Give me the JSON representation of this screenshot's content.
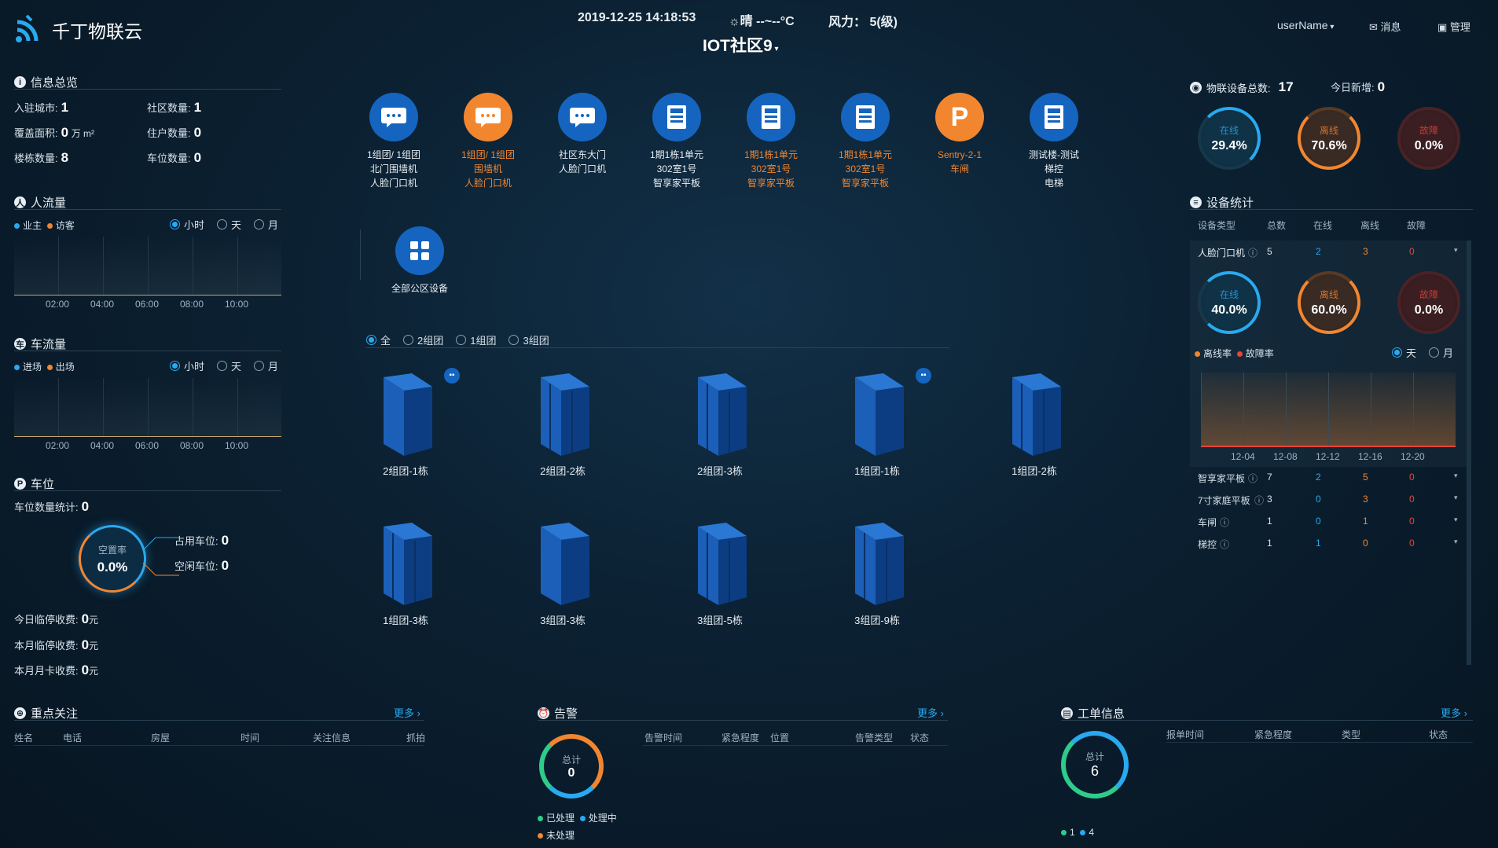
{
  "app": {
    "title": "千丁物联云"
  },
  "topbar": {
    "datetime": "2019-12-25 14:18:53",
    "weather": "晴 --~--°C",
    "wind": "风力： 5(级)",
    "community": "IOT社区9",
    "user": "userName",
    "messages": "消息",
    "admin": "管理"
  },
  "info": {
    "title": "信息总览",
    "city_label": "入驻城市:",
    "city": "1",
    "community_label": "社区数量:",
    "community": "1",
    "area_label": "覆盖面积:",
    "area": "0",
    "area_unit": "万 m²",
    "households_label": "住户数量:",
    "households": "0",
    "buildings_label": "楼栋数量:",
    "buildings": "8",
    "parking_label": "车位数量:",
    "parking": "0"
  },
  "people_flow": {
    "title": "人流量",
    "legend": [
      "业主",
      "访客"
    ],
    "options": [
      "小时",
      "天",
      "月"
    ],
    "selected": "小时",
    "x_ticks": [
      "02:00",
      "04:00",
      "06:00",
      "08:00",
      "10:00"
    ]
  },
  "car_flow": {
    "title": "车流量",
    "legend": [
      "进场",
      "出场"
    ],
    "options": [
      "小时",
      "天",
      "月"
    ],
    "selected": "小时",
    "x_ticks": [
      "02:00",
      "04:00",
      "06:00",
      "08:00",
      "10:00"
    ]
  },
  "parking": {
    "title": "车位",
    "stats_label": "车位数量统计:",
    "stats": "0",
    "ring_label": "空置率",
    "ring_value": "0.0%",
    "used_label": "占用车位:",
    "used": "0",
    "free_label": "空闲车位:",
    "free": "0",
    "today_label": "今日临停收费:",
    "today": "0",
    "month_label": "本月临停收费:",
    "month": "0",
    "card_label": "本月月卡收费:",
    "card": "0",
    "currency": "元"
  },
  "devices": [
    {
      "lines": [
        "1组团/ 1组团",
        "北门围墙机",
        "人脸门口机"
      ],
      "icon": "chat-icon",
      "color": "#1565c0",
      "state": "normal"
    },
    {
      "lines": [
        "1组团/ 1组团",
        "围墙机",
        "人脸门口机"
      ],
      "icon": "chat-icon",
      "color": "#f2862f",
      "state": "alert"
    },
    {
      "lines": [
        "社区东大门",
        "人脸门口机"
      ],
      "icon": "chat-icon",
      "color": "#1565c0",
      "state": "normal"
    },
    {
      "lines": [
        "1期1栋1单元",
        "302室1号",
        "智享家平板"
      ],
      "icon": "tablet-icon",
      "color": "#1565c0",
      "state": "normal"
    },
    {
      "lines": [
        "1期1栋1单元",
        "302室1号",
        "智享家平板"
      ],
      "icon": "tablet-icon",
      "color": "#1565c0",
      "state": "alert"
    },
    {
      "lines": [
        "1期1栋1单元",
        "302室1号",
        "智享家平板"
      ],
      "icon": "tablet-icon",
      "color": "#1565c0",
      "state": "alert"
    },
    {
      "lines": [
        "Sentry-2-1",
        "车闸"
      ],
      "icon": "parking-gate-icon",
      "color": "#f2862f",
      "state": "alert"
    },
    {
      "lines": [
        "测试楼-测试",
        "梯控",
        "电梯"
      ],
      "icon": "tablet-icon",
      "color": "#1565c0",
      "state": "normal"
    }
  ],
  "all_devices": "全部公区设备",
  "group_filter": {
    "options": [
      "全",
      "2组团",
      "1组团",
      "3组团"
    ],
    "selected": "全"
  },
  "buildings": [
    "2组团-1栋",
    "2组团-2栋",
    "2组团-3栋",
    "1组团-1栋",
    "1组团-2栋",
    "1组团-3栋",
    "3组团-3栋",
    "3组团-5栋",
    "3组团-9栋"
  ],
  "iot": {
    "total_label": "物联设备总数:",
    "total": "17",
    "new_label": "今日新增:",
    "new": "0",
    "online_label": "在线",
    "online": "29.4%",
    "offline_label": "离线",
    "offline": "70.6%",
    "fault_label": "故障",
    "fault": "0.0%"
  },
  "device_stats": {
    "title": "设备统计",
    "headers": [
      "设备类型",
      "总数",
      "在线",
      "离线",
      "故障"
    ],
    "first_row": {
      "name": "人脸门口机",
      "total": "5",
      "online": "2",
      "offline": "3",
      "fault": "0"
    },
    "rings": {
      "online": "40.0%",
      "offline": "60.0%",
      "fault": "0.0%",
      "online_label": "在线",
      "offline_label": "离线",
      "fault_label": "故障"
    },
    "legend": [
      "离线率",
      "故障率"
    ],
    "options": [
      "天",
      "月"
    ],
    "selected": "天",
    "x_ticks": [
      "12-04",
      "12-08",
      "12-12",
      "12-16",
      "12-20"
    ],
    "rows": [
      {
        "name": "智享家平板",
        "total": "7",
        "online": "2",
        "offline": "5",
        "fault": "0"
      },
      {
        "name": "7寸家庭平板",
        "total": "3",
        "online": "0",
        "offline": "3",
        "fault": "0"
      },
      {
        "name": "车闸",
        "total": "1",
        "online": "0",
        "offline": "1",
        "fault": "0"
      },
      {
        "name": "梯控",
        "total": "1",
        "online": "1",
        "offline": "0",
        "fault": "0"
      }
    ]
  },
  "focus": {
    "title": "重点关注",
    "more": "更多",
    "headers": [
      "姓名",
      "电话",
      "房屋",
      "时间",
      "关注信息",
      "抓拍"
    ]
  },
  "alarm": {
    "title": "告警",
    "more": "更多",
    "ring_label": "总计",
    "ring_value": "0",
    "legend": [
      "已处理",
      "处理中",
      "未处理"
    ],
    "headers": [
      "告警时间",
      "紧急程度",
      "位置",
      "告警类型",
      "状态"
    ]
  },
  "workorder": {
    "title": "工单信息",
    "more": "更多",
    "ring_label": "总计",
    "ring_value": "6",
    "legend_values": [
      "1",
      "4"
    ],
    "headers": [
      "报单时间",
      "紧急程度",
      "类型",
      "状态"
    ]
  },
  "colors": {
    "accent": "#29a9f0",
    "orange": "#f2862f",
    "red": "#e8443a",
    "green": "#2ecc8b"
  }
}
